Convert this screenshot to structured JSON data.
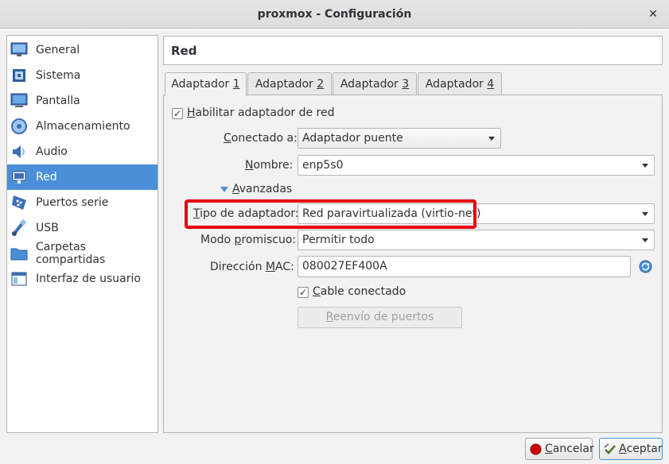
{
  "window": {
    "title": "proxmox - Configuración",
    "close_glyph": "✕"
  },
  "sidebar": {
    "items": [
      {
        "label": "General",
        "icon": "monitor-icon"
      },
      {
        "label": "Sistema",
        "icon": "chip-icon"
      },
      {
        "label": "Pantalla",
        "icon": "display-icon"
      },
      {
        "label": "Almacenamiento",
        "icon": "disk-icon"
      },
      {
        "label": "Audio",
        "icon": "speaker-icon"
      },
      {
        "label": "Red",
        "icon": "network-icon",
        "active": true
      },
      {
        "label": "Puertos serie",
        "icon": "serial-icon"
      },
      {
        "label": "USB",
        "icon": "usb-icon"
      },
      {
        "label": "Carpetas compartidas",
        "icon": "folder-icon"
      },
      {
        "label": "Interfaz de usuario",
        "icon": "ui-icon"
      }
    ]
  },
  "section_title": "Red",
  "tabs": [
    {
      "pre": "Adaptador ",
      "key": "1"
    },
    {
      "pre": "Adaptador ",
      "key": "2"
    },
    {
      "pre": "Adaptador ",
      "key": "3"
    },
    {
      "pre": "Adaptador ",
      "key": "4"
    }
  ],
  "adapter": {
    "enable": {
      "pre": "",
      "key": "H",
      "post": "abilitar adaptador de red",
      "checked": true
    },
    "connected_to": {
      "pre": "",
      "key": "C",
      "post": "onectado a:",
      "value": "Adaptador puente"
    },
    "name": {
      "pre": "",
      "key": "N",
      "post": "ombre:",
      "value": "enp5s0"
    },
    "advanced": {
      "pre": "",
      "key": "A",
      "post": "vanzadas"
    },
    "adapter_type": {
      "pre": "",
      "key": "T",
      "post": "ipo de adaptador:",
      "value": "Red paravirtualizada (virtio-net)"
    },
    "promiscuous": {
      "pre": "Modo ",
      "key": "p",
      "post": "romiscuo:",
      "value": "Permitir todo"
    },
    "mac": {
      "pre": "Dirección ",
      "key": "M",
      "post": "AC:",
      "value": "080027EF400A"
    },
    "cable": {
      "pre": "",
      "key": "C",
      "post": "able conectado",
      "checked": true
    },
    "port_forwarding": {
      "pre": "",
      "key": "R",
      "post": "eenvío de puertos"
    }
  },
  "footer": {
    "cancel": {
      "pre": "",
      "key": "C",
      "post": "ancelar"
    },
    "accept": {
      "pre": "",
      "key": "A",
      "post": "ceptar"
    }
  },
  "colors": {
    "accent": "#4a90d9",
    "highlight": "#e8000d"
  }
}
